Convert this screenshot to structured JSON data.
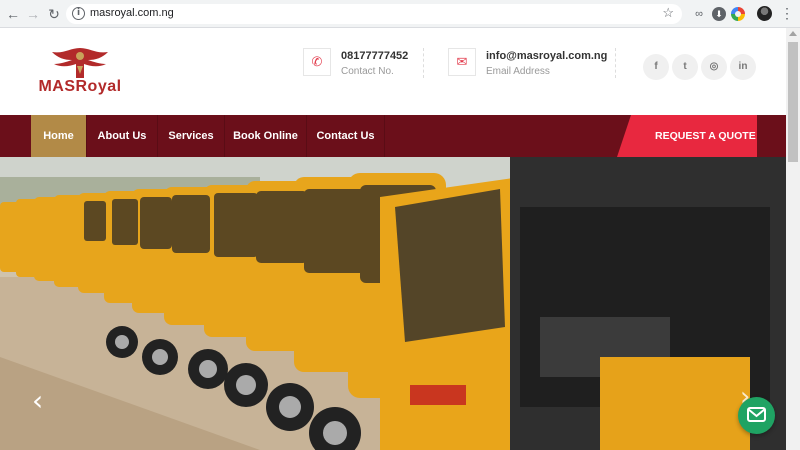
{
  "browser": {
    "url": "masroyal.com.ng"
  },
  "header": {
    "logo_text": "MASRoyal",
    "phone": {
      "value": "08177777452",
      "label": "Contact No."
    },
    "email": {
      "value": "info@masroyal.com.ng",
      "label": "Email Address"
    },
    "social": [
      {
        "icon": "facebook-icon",
        "glyph": "f"
      },
      {
        "icon": "twitter-icon",
        "glyph": "t"
      },
      {
        "icon": "instagram-icon",
        "glyph": "◎"
      },
      {
        "icon": "linkedin-icon",
        "glyph": "in"
      }
    ]
  },
  "nav": {
    "items": [
      {
        "label": "Home",
        "active": true
      },
      {
        "label": "About Us"
      },
      {
        "label": "Services"
      },
      {
        "label": "Book Online"
      },
      {
        "label": "Contact Us"
      }
    ],
    "cta": "REQUEST A QUOTE"
  },
  "colors": {
    "nav_bg": "#6b0f1a",
    "nav_active": "#b28a47",
    "cta": "#e8283f",
    "chat": "#1fa363",
    "accent_icon": "#e23b4c"
  },
  "hero": {
    "image": "row of yellow tricycles (keke) parked in a line",
    "prev_icon": "chevron-left-icon",
    "next_icon": "chevron-right-icon"
  },
  "chat": {
    "icon": "message-icon"
  }
}
